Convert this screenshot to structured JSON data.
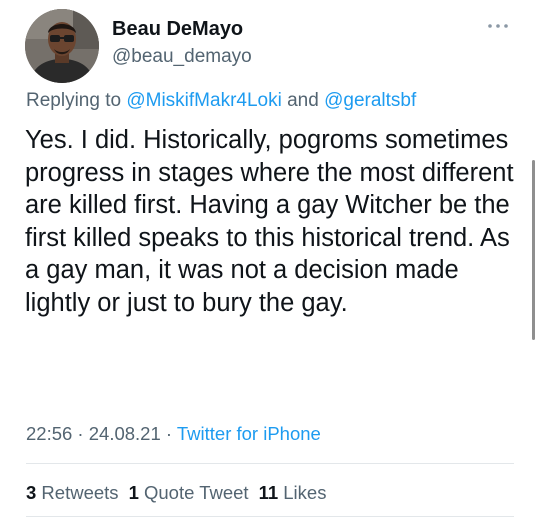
{
  "author": {
    "display_name": "Beau DeMayo",
    "handle": "@beau_demayo",
    "avatar_icon": "profile-photo"
  },
  "menu_icon": "more-options-icon",
  "reply_context": {
    "prefix": "Replying to ",
    "mentions": [
      "@MiskifMakr4Loki",
      "@geraltsbf"
    ],
    "conjunction": " and "
  },
  "tweet": {
    "text": "Yes. I did. Historically, pogroms sometimes progress in stages where the most different are killed first. Having a gay Witcher be the first killed speaks to this historical trend. As a gay man, it was not a decision made lightly or just to bury the gay."
  },
  "meta": {
    "time": "22:56",
    "separator1": " · ",
    "date": "24.08.21",
    "separator2": " · ",
    "source": "Twitter for iPhone"
  },
  "stats": {
    "retweets": {
      "count": "3",
      "label": " Retweets"
    },
    "quote_tweets": {
      "count": "1",
      "label": " Quote Tweet"
    },
    "likes": {
      "count": "11",
      "label": " Likes"
    }
  },
  "colors": {
    "text_primary": "#0f1419",
    "text_secondary": "#536471",
    "link": "#1d9bf0",
    "divider": "#e3e7ea"
  }
}
